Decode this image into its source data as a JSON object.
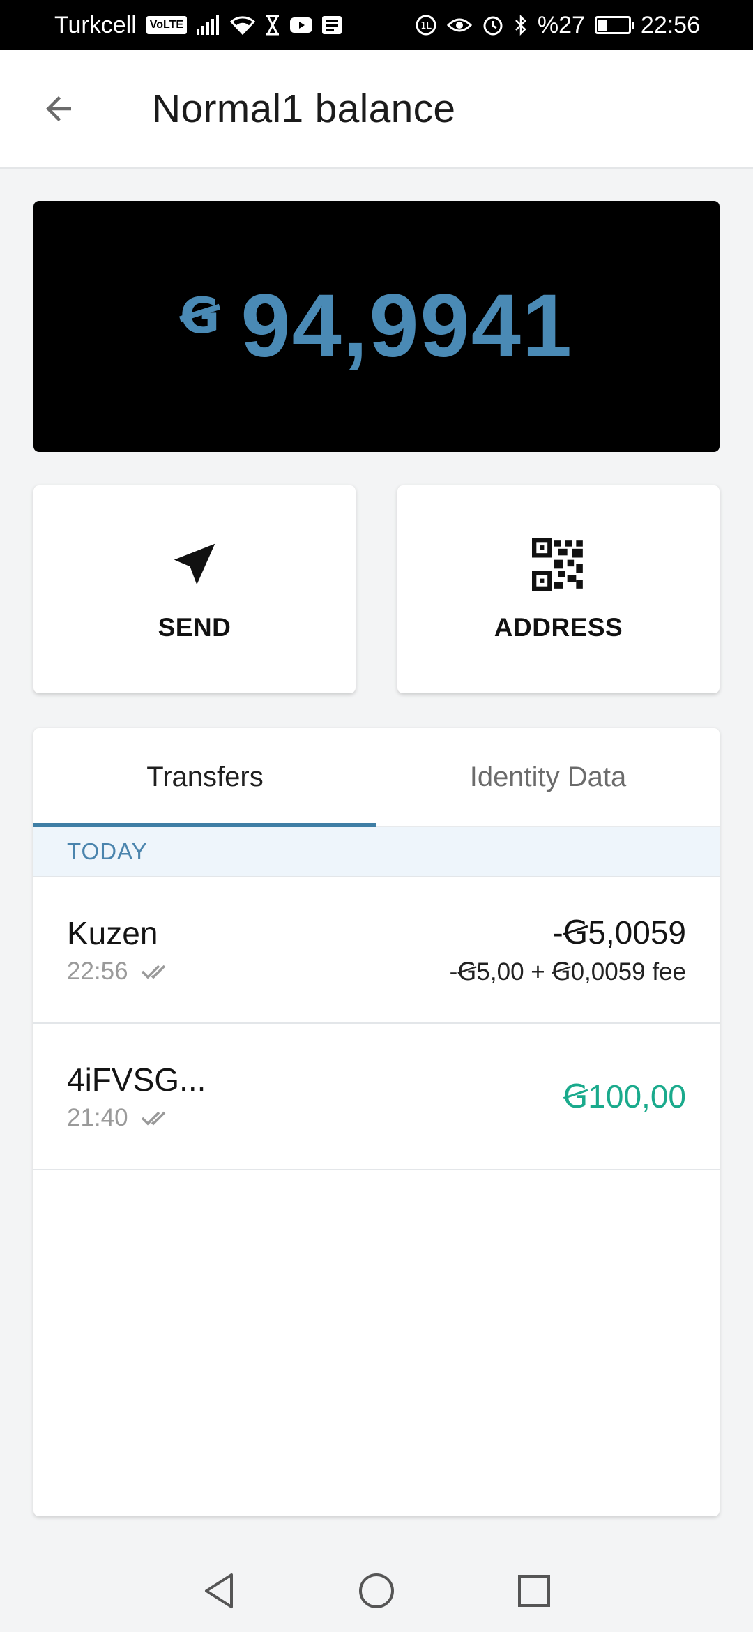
{
  "status_bar": {
    "carrier": "Turkcell",
    "volte": "VoLTE",
    "battery_text": "%27",
    "battery_level": 0.27,
    "time": "22:56",
    "left_icons": [
      "signal-icon",
      "wifi-icon",
      "hourglass-icon",
      "youtube-icon",
      "news-icon"
    ],
    "right_icons": [
      "nfc-icon",
      "eye-icon",
      "alarm-icon",
      "bluetooth-icon",
      "battery-icon"
    ]
  },
  "header": {
    "title": "Normal1 balance",
    "back_icon": "arrow-left-icon"
  },
  "balance": {
    "currency_symbol": "Ꞡ",
    "amount": "94,9941",
    "color": "#4a8ab5"
  },
  "actions": {
    "send_label": "SEND",
    "send_icon": "send-plane-icon",
    "address_label": "ADDRESS",
    "address_icon": "qr-code-icon"
  },
  "tabs": [
    {
      "label": "Transfers",
      "active": true
    },
    {
      "label": "Identity Data",
      "active": false
    }
  ],
  "transfers": {
    "section_label": "TODAY",
    "items": [
      {
        "name": "Kuzen",
        "time": "22:56",
        "status_icon": "double-check-icon",
        "amount": "-Ꞡ5,0059",
        "detail": "-Ꞡ5,00 + Ꞡ0,0059 fee"
      },
      {
        "name": "4iFVSG...",
        "time": "21:40",
        "status_icon": "double-check-icon",
        "amount": "Ꞡ100,00",
        "detail": ""
      }
    ],
    "positive_color": "#1aaa8c"
  },
  "nav_bar": {
    "icons": [
      "back-triangle-icon",
      "home-circle-icon",
      "recents-square-icon"
    ]
  }
}
